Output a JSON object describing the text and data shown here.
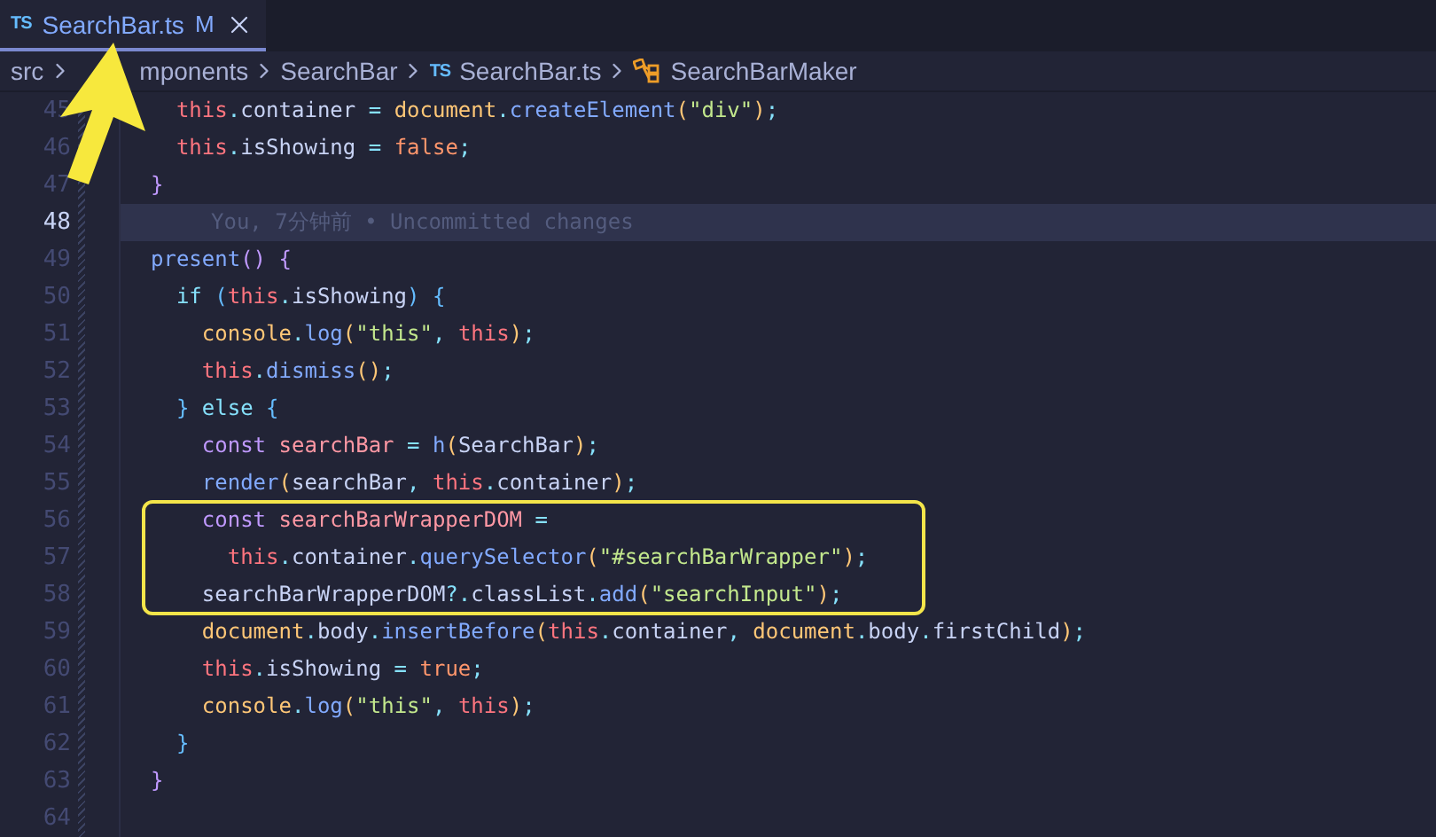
{
  "tab": {
    "file_icon": "TS",
    "title": "SearchBar.ts",
    "status": "M",
    "selected": true
  },
  "breadcrumb": [
    {
      "label": "src",
      "kind": "folder"
    },
    {
      "label": "mponents",
      "kind": "covered"
    },
    {
      "label": "SearchBar",
      "kind": "folder"
    },
    {
      "label": "SearchBar.ts",
      "kind": "file",
      "file_icon": "TS"
    },
    {
      "label": "SearchBarMaker",
      "kind": "symbol"
    }
  ],
  "lines": [
    {
      "number": "45",
      "current": false,
      "highlighted": false,
      "tokens": [
        {
          "text": "  this",
          "kind": "this"
        },
        {
          "text": ".",
          "kind": "punc"
        },
        {
          "text": "container",
          "kind": "plain"
        },
        {
          "text": " = ",
          "kind": "punc"
        },
        {
          "text": "document",
          "kind": "obj"
        },
        {
          "text": ".",
          "kind": "punc"
        },
        {
          "text": "createElement",
          "kind": "fn"
        },
        {
          "text": "(",
          "kind": "paren"
        },
        {
          "text": "\"div\"",
          "kind": "str"
        },
        {
          "text": ")",
          "kind": "paren"
        },
        {
          "text": ";",
          "kind": "punc"
        }
      ]
    },
    {
      "number": "46",
      "current": false,
      "highlighted": false,
      "tokens": [
        {
          "text": "  this",
          "kind": "this"
        },
        {
          "text": ".",
          "kind": "punc"
        },
        {
          "text": "isShowing",
          "kind": "plain"
        },
        {
          "text": " = ",
          "kind": "punc"
        },
        {
          "text": "false",
          "kind": "bool"
        },
        {
          "text": ";",
          "kind": "punc"
        }
      ]
    },
    {
      "number": "47",
      "current": false,
      "highlighted": false,
      "tokens": [
        {
          "text": "}",
          "kind": "brace2"
        }
      ]
    },
    {
      "number": "48",
      "current": true,
      "highlighted": false,
      "annotation": "You, 7分钟前 • Uncommitted changes"
    },
    {
      "number": "49",
      "current": false,
      "highlighted": false,
      "tokens": [
        {
          "text": "present",
          "kind": "fn"
        },
        {
          "text": "() {",
          "kind": "brace2"
        }
      ]
    },
    {
      "number": "50",
      "current": false,
      "highlighted": false,
      "tokens": [
        {
          "text": "  if",
          "kind": "ctrl"
        },
        {
          "text": " (",
          "kind": "brace"
        },
        {
          "text": "this",
          "kind": "this"
        },
        {
          "text": ".",
          "kind": "punc"
        },
        {
          "text": "isShowing",
          "kind": "plain"
        },
        {
          "text": ") {",
          "kind": "brace"
        }
      ]
    },
    {
      "number": "51",
      "current": false,
      "highlighted": false,
      "tokens": [
        {
          "text": "    console",
          "kind": "obj"
        },
        {
          "text": ".",
          "kind": "punc"
        },
        {
          "text": "log",
          "kind": "fn"
        },
        {
          "text": "(",
          "kind": "paren"
        },
        {
          "text": "\"this\"",
          "kind": "str"
        },
        {
          "text": ", ",
          "kind": "punc"
        },
        {
          "text": "this",
          "kind": "this"
        },
        {
          "text": ")",
          "kind": "paren"
        },
        {
          "text": ";",
          "kind": "punc"
        }
      ]
    },
    {
      "number": "52",
      "current": false,
      "highlighted": false,
      "tokens": [
        {
          "text": "    this",
          "kind": "this"
        },
        {
          "text": ".",
          "kind": "punc"
        },
        {
          "text": "dismiss",
          "kind": "fn"
        },
        {
          "text": "()",
          "kind": "paren"
        },
        {
          "text": ";",
          "kind": "punc"
        }
      ]
    },
    {
      "number": "53",
      "current": false,
      "highlighted": false,
      "tokens": [
        {
          "text": "  }",
          "kind": "brace"
        },
        {
          "text": " else ",
          "kind": "ctrl"
        },
        {
          "text": "{",
          "kind": "brace"
        }
      ]
    },
    {
      "number": "54",
      "current": false,
      "highlighted": false,
      "tokens": [
        {
          "text": "    const",
          "kind": "kw"
        },
        {
          "text": " searchBar",
          "kind": "var"
        },
        {
          "text": " = ",
          "kind": "punc"
        },
        {
          "text": "h",
          "kind": "fn"
        },
        {
          "text": "(",
          "kind": "paren"
        },
        {
          "text": "SearchBar",
          "kind": "plain"
        },
        {
          "text": ")",
          "kind": "paren"
        },
        {
          "text": ";",
          "kind": "punc"
        }
      ]
    },
    {
      "number": "55",
      "current": false,
      "highlighted": false,
      "tokens": [
        {
          "text": "    render",
          "kind": "fn"
        },
        {
          "text": "(",
          "kind": "paren"
        },
        {
          "text": "searchBar",
          "kind": "plain"
        },
        {
          "text": ", ",
          "kind": "punc"
        },
        {
          "text": "this",
          "kind": "this"
        },
        {
          "text": ".",
          "kind": "punc"
        },
        {
          "text": "container",
          "kind": "plain"
        },
        {
          "text": ")",
          "kind": "paren"
        },
        {
          "text": ";",
          "kind": "punc"
        }
      ]
    },
    {
      "number": "56",
      "current": false,
      "highlighted": true,
      "tokens": [
        {
          "text": "    const",
          "kind": "kw"
        },
        {
          "text": " searchBarWrapperDOM",
          "kind": "var"
        },
        {
          "text": " =",
          "kind": "punc"
        }
      ]
    },
    {
      "number": "57",
      "current": false,
      "highlighted": true,
      "tokens": [
        {
          "text": "      this",
          "kind": "this"
        },
        {
          "text": ".",
          "kind": "punc"
        },
        {
          "text": "container",
          "kind": "plain"
        },
        {
          "text": ".",
          "kind": "punc"
        },
        {
          "text": "querySelector",
          "kind": "fn"
        },
        {
          "text": "(",
          "kind": "paren"
        },
        {
          "text": "\"#searchBarWrapper\"",
          "kind": "str"
        },
        {
          "text": ")",
          "kind": "paren"
        },
        {
          "text": ";",
          "kind": "punc"
        }
      ]
    },
    {
      "number": "58",
      "current": false,
      "highlighted": true,
      "tokens": [
        {
          "text": "    searchBarWrapperDOM",
          "kind": "plain"
        },
        {
          "text": "?.",
          "kind": "punc"
        },
        {
          "text": "classList",
          "kind": "plain"
        },
        {
          "text": ".",
          "kind": "punc"
        },
        {
          "text": "add",
          "kind": "fn"
        },
        {
          "text": "(",
          "kind": "paren"
        },
        {
          "text": "\"searchInput\"",
          "kind": "str"
        },
        {
          "text": ")",
          "kind": "paren"
        },
        {
          "text": ";",
          "kind": "punc"
        }
      ]
    },
    {
      "number": "59",
      "current": false,
      "highlighted": false,
      "tokens": [
        {
          "text": "    document",
          "kind": "obj"
        },
        {
          "text": ".",
          "kind": "punc"
        },
        {
          "text": "body",
          "kind": "plain"
        },
        {
          "text": ".",
          "kind": "punc"
        },
        {
          "text": "insertBefore",
          "kind": "fn"
        },
        {
          "text": "(",
          "kind": "paren"
        },
        {
          "text": "this",
          "kind": "this"
        },
        {
          "text": ".",
          "kind": "punc"
        },
        {
          "text": "container",
          "kind": "plain"
        },
        {
          "text": ", ",
          "kind": "punc"
        },
        {
          "text": "document",
          "kind": "obj"
        },
        {
          "text": ".",
          "kind": "punc"
        },
        {
          "text": "body",
          "kind": "plain"
        },
        {
          "text": ".",
          "kind": "punc"
        },
        {
          "text": "firstChild",
          "kind": "plain"
        },
        {
          "text": ")",
          "kind": "paren"
        },
        {
          "text": ";",
          "kind": "punc"
        }
      ]
    },
    {
      "number": "60",
      "current": false,
      "highlighted": false,
      "tokens": [
        {
          "text": "    this",
          "kind": "this"
        },
        {
          "text": ".",
          "kind": "punc"
        },
        {
          "text": "isShowing",
          "kind": "plain"
        },
        {
          "text": " = ",
          "kind": "punc"
        },
        {
          "text": "true",
          "kind": "bool"
        },
        {
          "text": ";",
          "kind": "punc"
        }
      ]
    },
    {
      "number": "61",
      "current": false,
      "highlighted": false,
      "tokens": [
        {
          "text": "    console",
          "kind": "obj"
        },
        {
          "text": ".",
          "kind": "punc"
        },
        {
          "text": "log",
          "kind": "fn"
        },
        {
          "text": "(",
          "kind": "paren"
        },
        {
          "text": "\"this\"",
          "kind": "str"
        },
        {
          "text": ", ",
          "kind": "punc"
        },
        {
          "text": "this",
          "kind": "this"
        },
        {
          "text": ")",
          "kind": "paren"
        },
        {
          "text": ";",
          "kind": "punc"
        }
      ]
    },
    {
      "number": "62",
      "current": false,
      "highlighted": false,
      "tokens": [
        {
          "text": "  }",
          "kind": "brace"
        }
      ]
    },
    {
      "number": "63",
      "current": false,
      "highlighted": false,
      "tokens": [
        {
          "text": "}",
          "kind": "brace2"
        }
      ]
    },
    {
      "number": "64",
      "current": false,
      "highlighted": false
    }
  ]
}
